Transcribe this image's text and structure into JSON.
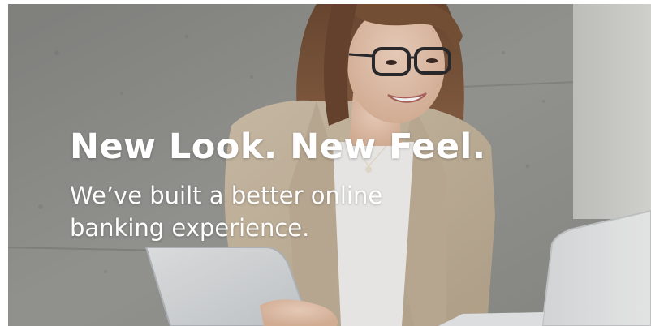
{
  "hero": {
    "headline": "New Look. New Feel.",
    "subline": "We’ve built a better online banking experience.",
    "image_alt": "Smiling woman with glasses holding a tablet next to a laptop",
    "colors": {
      "text": "#ffffff",
      "wall": "#8f8f8b",
      "jacket": "#c7b7a0"
    }
  }
}
